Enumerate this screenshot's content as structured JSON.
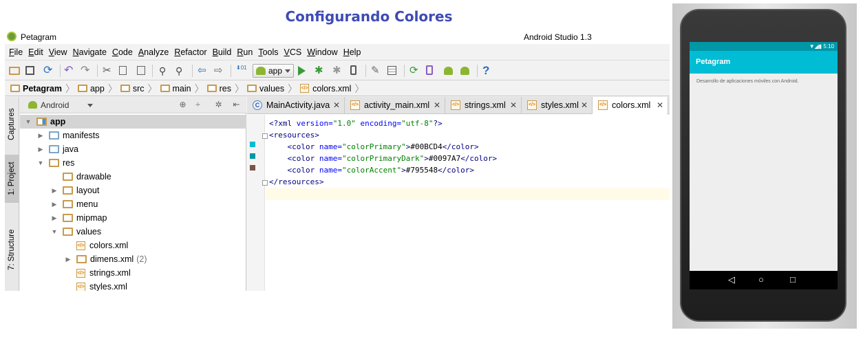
{
  "slide": {
    "title": "Configurando Colores"
  },
  "window": {
    "title": "Petagram",
    "app_name": "Android Studio 1.3"
  },
  "menu": [
    "File",
    "Edit",
    "View",
    "Navigate",
    "Code",
    "Analyze",
    "Refactor",
    "Build",
    "Run",
    "Tools",
    "VCS",
    "Window",
    "Help"
  ],
  "toolbar": {
    "run_config": "app"
  },
  "breadcrumb": [
    "Petagram",
    "app",
    "src",
    "main",
    "res",
    "values",
    "colors.xml"
  ],
  "side_tabs": [
    "Captures",
    "1: Project",
    "7: Structure"
  ],
  "project_panel": {
    "view_selector": "Android",
    "tree": [
      {
        "label": "app",
        "count": ""
      },
      {
        "label": "manifests",
        "count": ""
      },
      {
        "label": "java",
        "count": ""
      },
      {
        "label": "res",
        "count": ""
      },
      {
        "label": "drawable",
        "count": ""
      },
      {
        "label": "layout",
        "count": ""
      },
      {
        "label": "menu",
        "count": ""
      },
      {
        "label": "mipmap",
        "count": ""
      },
      {
        "label": "values",
        "count": ""
      },
      {
        "label": "colors.xml",
        "count": ""
      },
      {
        "label": "dimens.xml",
        "count": "(2)"
      },
      {
        "label": "strings.xml",
        "count": ""
      },
      {
        "label": "styles.xml",
        "count": ""
      }
    ]
  },
  "editor": {
    "tabs": [
      "MainActivity.java",
      "activity_main.xml",
      "strings.xml",
      "styles.xml",
      "colors.xml"
    ],
    "active_tab": "colors.xml",
    "swatches": [
      "#00BCD4",
      "#0097A7",
      "#795548"
    ]
  },
  "phone": {
    "time": "5:10",
    "app_title": "Petagram",
    "content_text": "Desarrollo de aplicaciones móviles con Android."
  }
}
